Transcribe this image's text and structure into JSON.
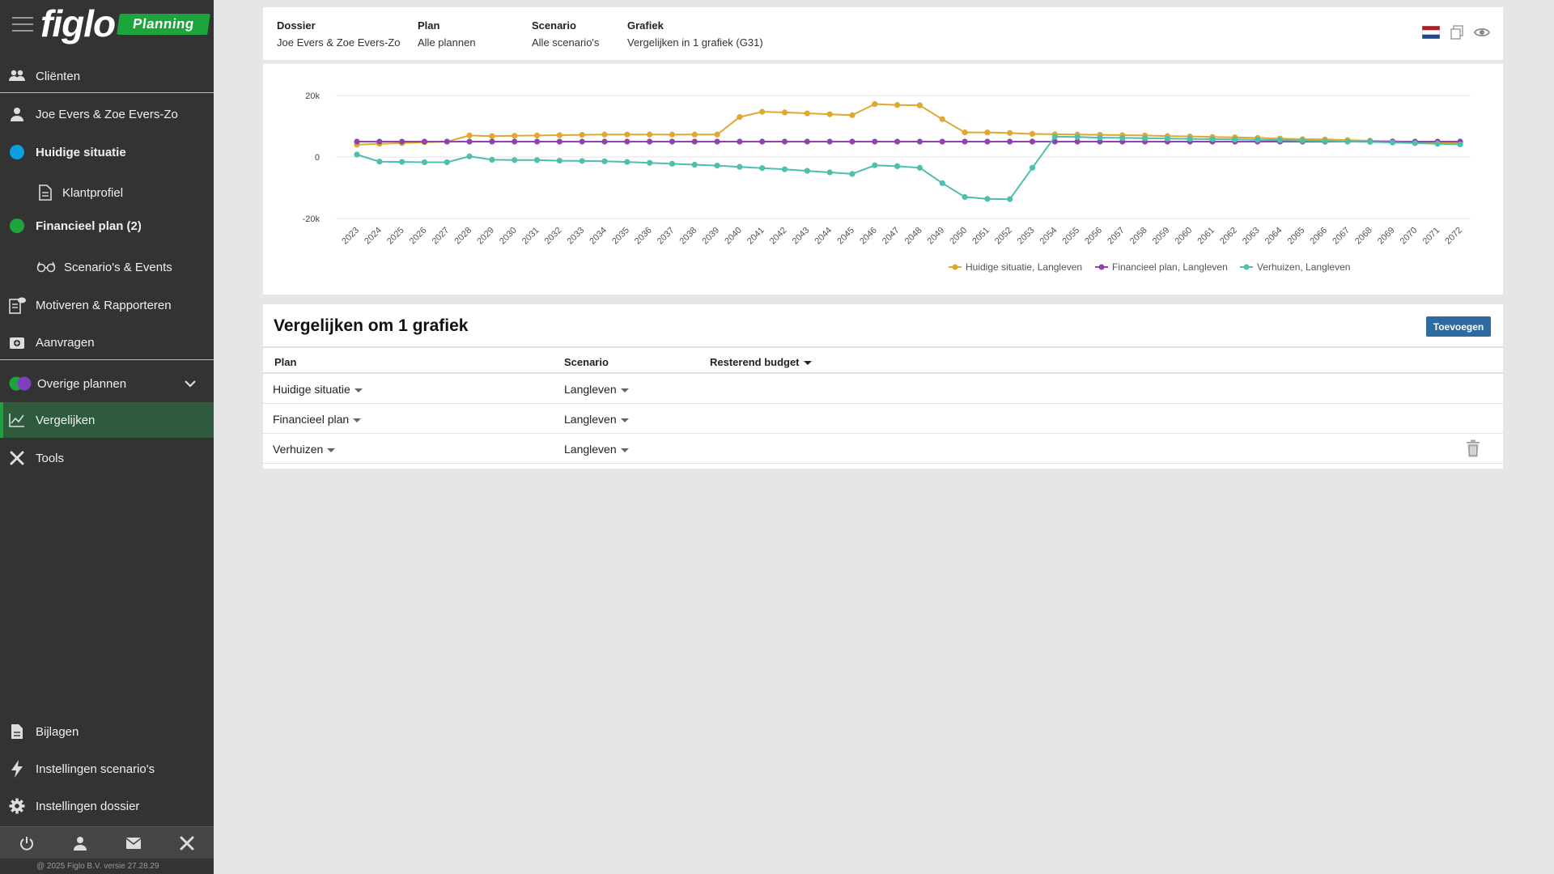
{
  "brand": {
    "logo": "figlo",
    "badge": "Planning"
  },
  "sidebar": {
    "items": [
      {
        "label": "Cliënten",
        "icon": "users-icon"
      },
      {
        "label": "Joe Evers & Zoe Evers-Zo",
        "icon": "user-icon"
      },
      {
        "label": "Huidige situatie",
        "icon": "blue-dot-icon"
      },
      {
        "label": "Klantprofiel",
        "icon": "document-icon"
      },
      {
        "label": "Financieel plan (2)",
        "icon": "green-dot-icon"
      },
      {
        "label": "Scenario's & Events",
        "icon": "glasses-icon"
      },
      {
        "label": "Motiveren & Rapporteren",
        "icon": "report-icon"
      },
      {
        "label": "Aanvragen",
        "icon": "request-icon"
      },
      {
        "label": "Overige plannen",
        "icon": "plans-dots-icon"
      },
      {
        "label": "Vergelijken",
        "icon": "compare-chart-icon"
      },
      {
        "label": "Tools",
        "icon": "tools-icon"
      }
    ],
    "bottom_items": [
      {
        "label": "Bijlagen",
        "icon": "attachment-icon"
      },
      {
        "label": "Instellingen scenario's",
        "icon": "bolt-icon"
      },
      {
        "label": "Instellingen dossier",
        "icon": "gear-icon"
      }
    ],
    "footer": "@ 2025 Figlo B.V. versie 27.28.29"
  },
  "header": {
    "dossier_label": "Dossier",
    "dossier_value": "Joe Evers & Zoe Evers-Zo",
    "plan_label": "Plan",
    "plan_value": "Alle plannen",
    "scenario_label": "Scenario",
    "scenario_value": "Alle scenario's",
    "grafiek_label": "Grafiek",
    "grafiek_value": "Vergelijken in 1 grafiek (G31)"
  },
  "colors": {
    "huidige": "#e0a82e",
    "financieel": "#8e44ad",
    "verhuizen": "#4dbfac",
    "sidebar": "#333333",
    "accent": "#1ca53c",
    "button": "#2d6a9f"
  },
  "chart_data": {
    "type": "line",
    "x": [
      2023,
      2024,
      2025,
      2026,
      2027,
      2028,
      2029,
      2030,
      2031,
      2032,
      2033,
      2034,
      2035,
      2036,
      2037,
      2038,
      2039,
      2040,
      2041,
      2042,
      2043,
      2044,
      2045,
      2046,
      2047,
      2048,
      2049,
      2050,
      2051,
      2052,
      2053,
      2054,
      2055,
      2056,
      2057,
      2058,
      2059,
      2060,
      2061,
      2062,
      2063,
      2064,
      2065,
      2066,
      2067,
      2068,
      2069,
      2070,
      2071,
      2072
    ],
    "ylim": [
      -20000,
      20000
    ],
    "yticks": [
      {
        "value": 20000,
        "label": "20k"
      },
      {
        "value": 0,
        "label": "0"
      },
      {
        "value": -20000,
        "label": "-20k"
      }
    ],
    "grid": true,
    "legend_position": "bottom",
    "series": [
      {
        "name": "Huidige situatie, Langleven",
        "color": "#e0a82e",
        "values": [
          4000,
          4300,
          4500,
          4800,
          5000,
          7000,
          6800,
          6900,
          7000,
          7100,
          7200,
          7300,
          7300,
          7300,
          7300,
          7300,
          7300,
          13000,
          14700,
          14500,
          14200,
          13900,
          13600,
          17200,
          16900,
          16800,
          12300,
          8000,
          8000,
          7800,
          7500,
          7400,
          7300,
          7200,
          7100,
          7000,
          6800,
          6700,
          6500,
          6400,
          6200,
          6000,
          5800,
          5700,
          5500,
          5300,
          5100,
          4900,
          4700,
          4500
        ]
      },
      {
        "name": "Financieel plan, Langleven",
        "color": "#8e44ad",
        "values": [
          5000,
          5000,
          5000,
          5000,
          5000,
          5000,
          5000,
          5000,
          5000,
          5000,
          5000,
          5000,
          5000,
          5000,
          5000,
          5000,
          5000,
          5000,
          5000,
          5000,
          5000,
          5000,
          5000,
          5000,
          5000,
          5000,
          5000,
          5000,
          5000,
          5000,
          5000,
          5000,
          5000,
          5000,
          5000,
          5000,
          5000,
          5000,
          5000,
          5000,
          5000,
          5000,
          5000,
          5000,
          5000,
          5000,
          5000,
          5000,
          5000,
          5000
        ]
      },
      {
        "name": "Verhuizen, Langleven",
        "color": "#4dbfac",
        "values": [
          800,
          -1500,
          -1600,
          -1700,
          -1700,
          200,
          -900,
          -1000,
          -1000,
          -1200,
          -1300,
          -1400,
          -1600,
          -1900,
          -2200,
          -2500,
          -2800,
          -3200,
          -3600,
          -4000,
          -4500,
          -5000,
          -5500,
          -2700,
          -3000,
          -3500,
          -8500,
          -13000,
          -13600,
          -13700,
          -3500,
          6600,
          6500,
          6300,
          6200,
          6100,
          6000,
          5900,
          5800,
          5700,
          5600,
          5500,
          5300,
          5200,
          5000,
          4900,
          4700,
          4500,
          4300,
          4100
        ]
      }
    ]
  },
  "table": {
    "title": "Vergelijken om 1 grafiek",
    "add_button": "Toevoegen",
    "col_plan": "Plan",
    "col_scenario": "Scenario",
    "col_budget": "Resterend budget",
    "rows": [
      {
        "plan": "Huidige situatie",
        "scenario": "Langleven"
      },
      {
        "plan": "Financieel plan",
        "scenario": "Langleven"
      },
      {
        "plan": "Verhuizen",
        "scenario": "Langleven"
      }
    ]
  }
}
